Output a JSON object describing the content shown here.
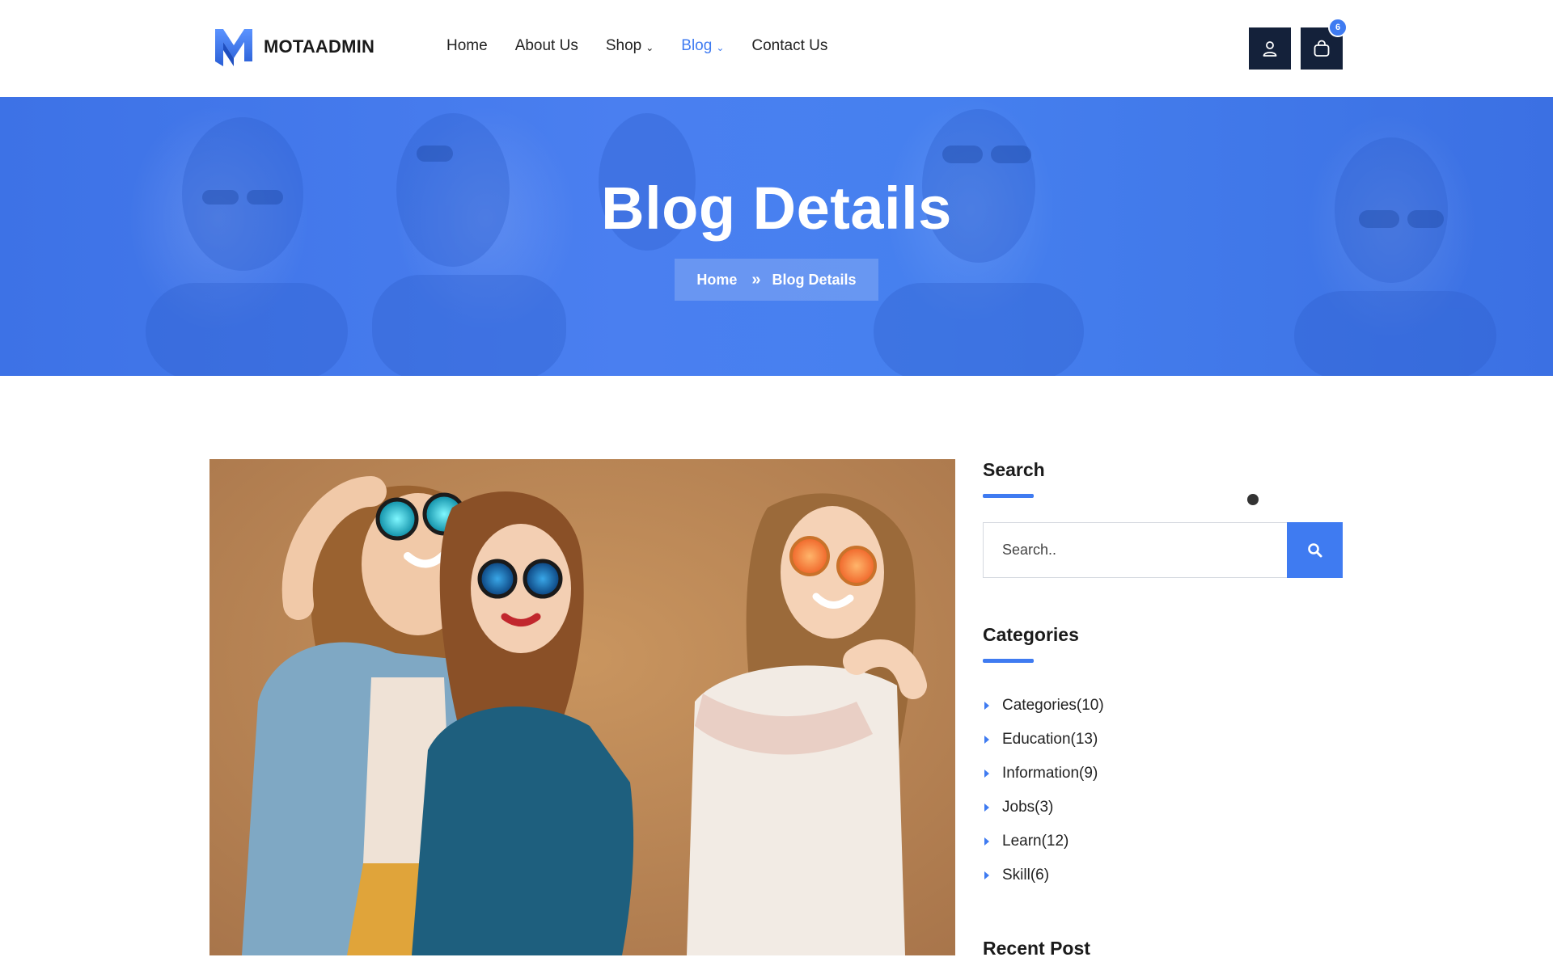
{
  "brand": {
    "name": "MOTAADMIN",
    "accent": "#3f7bf1",
    "dark": "#14213a"
  },
  "nav": {
    "items": [
      {
        "label": "Home",
        "active": false,
        "dropdown": false
      },
      {
        "label": "About Us",
        "active": false,
        "dropdown": false
      },
      {
        "label": "Shop",
        "active": false,
        "dropdown": true
      },
      {
        "label": "Blog",
        "active": true,
        "dropdown": true
      },
      {
        "label": "Contact Us",
        "active": false,
        "dropdown": false
      }
    ]
  },
  "header_actions": {
    "user_icon": "user-icon",
    "cart_icon": "shopping-bag-icon",
    "cart_count": "6"
  },
  "banner": {
    "title": "Blog Details",
    "breadcrumb": {
      "home": "Home",
      "separator": "»",
      "current": "Blog Details"
    }
  },
  "post": {
    "image": "three-women-sunglasses-photo"
  },
  "sidebar": {
    "search": {
      "title": "Search",
      "placeholder": "Search..",
      "button_icon": "search-icon"
    },
    "categories": {
      "title": "Categories",
      "items": [
        {
          "label": "Categories(10)"
        },
        {
          "label": "Education(13)"
        },
        {
          "label": "Information(9)"
        },
        {
          "label": "Jobs(3)"
        },
        {
          "label": "Learn(12)"
        },
        {
          "label": "Skill(6)"
        }
      ]
    },
    "recent_post": {
      "title": "Recent Post"
    }
  }
}
